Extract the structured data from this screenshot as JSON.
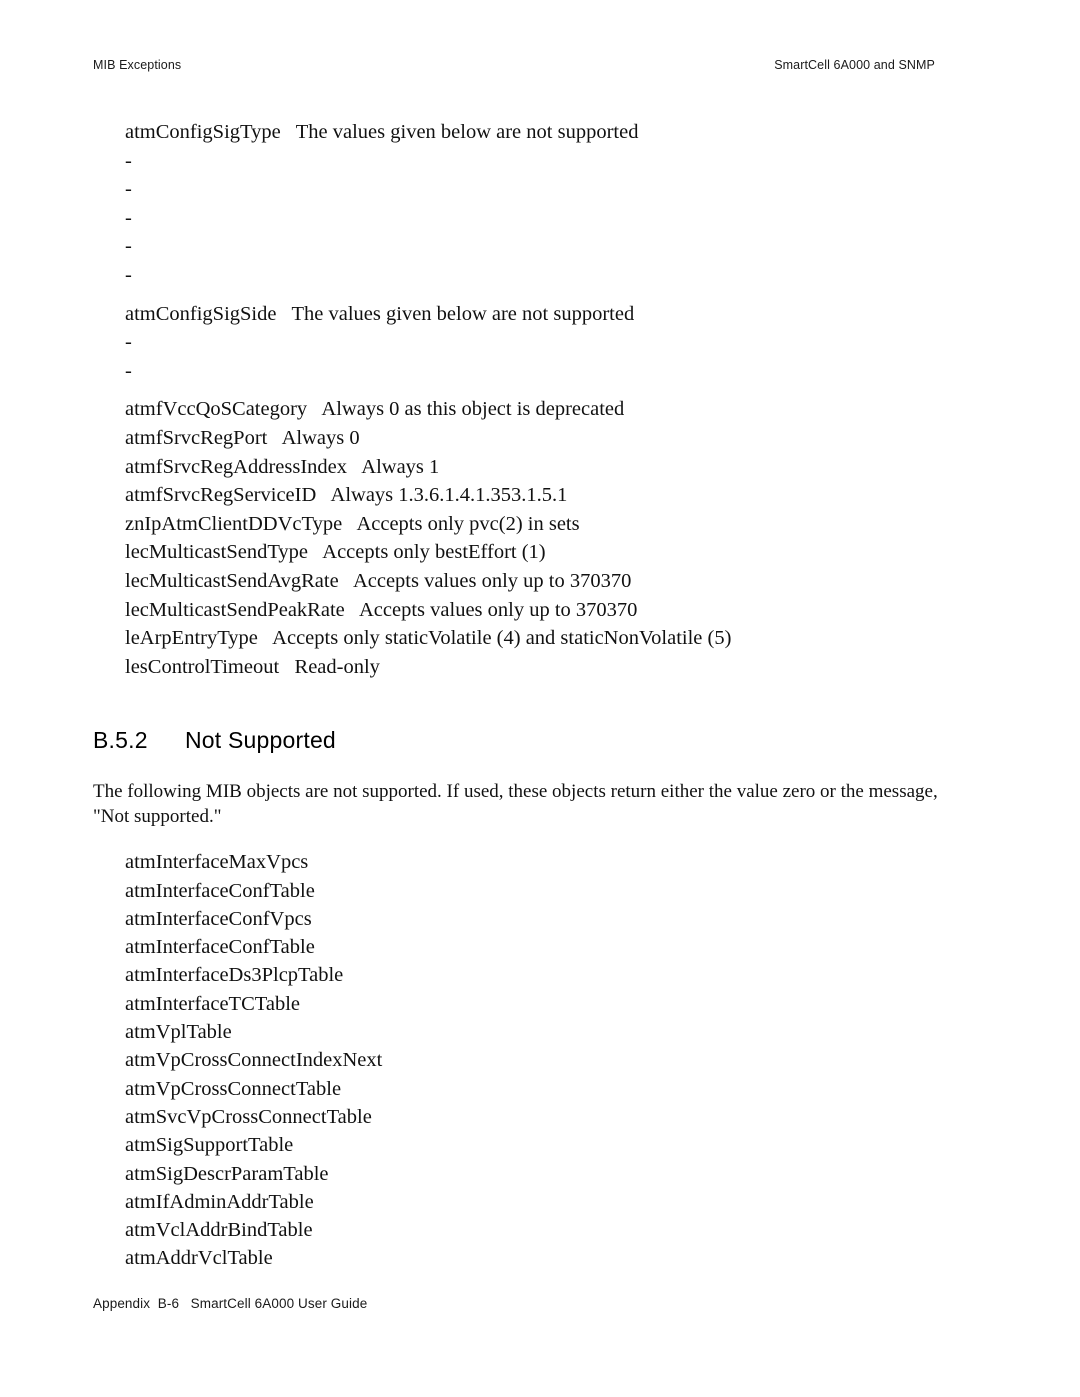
{
  "header": {
    "left": "MIB Exceptions",
    "right": "SmartCell 6A000 and SNMP"
  },
  "exceptions": {
    "entries": [
      {
        "name": "atmConfigSigType",
        "description": "The values given below are not supported",
        "dashes": 5
      },
      {
        "name": "atmConfigSigSide",
        "description": "The values given below are not supported",
        "dashes": 2
      },
      {
        "name": "atmfVccQoSCategory",
        "description": "Always 0 as this object is deprecated",
        "dashes": 0
      },
      {
        "name": "atmfSrvcRegPort",
        "description": "Always 0",
        "dashes": 0
      },
      {
        "name": "atmfSrvcRegAddressIndex",
        "description": "Always 1",
        "dashes": 0
      },
      {
        "name": "atmfSrvcRegServiceID",
        "description": "Always 1.3.6.1.4.1.353.1.5.1",
        "dashes": 0
      },
      {
        "name": "znIpAtmClientDDVcType",
        "description": "Accepts only pvc(2) in sets",
        "dashes": 0
      },
      {
        "name": "lecMulticastSendType",
        "description": "Accepts only bestEffort (1)",
        "dashes": 0
      },
      {
        "name": "lecMulticastSendAvgRate",
        "description": "Accepts values only up to 370370",
        "dashes": 0
      },
      {
        "name": "lecMulticastSendPeakRate",
        "description": "Accepts values only up to 370370",
        "dashes": 0
      },
      {
        "name": "leArpEntryType",
        "description": "Accepts only staticVolatile (4) and staticNonVolatile (5)",
        "dashes": 0
      },
      {
        "name": "lesControlTimeout",
        "description": "Read-only",
        "dashes": 0
      }
    ],
    "dash_glyph": "-"
  },
  "section": {
    "number": "B.5.2",
    "title": "Not Supported",
    "intro": "The following MIB objects are not supported. If used, these objects return either the value zero or the message, \"Not supported.\"",
    "items": [
      "atmInterfaceMaxVpcs",
      "atmInterfaceConfTable",
      "atmInterfaceConfVpcs",
      "atmInterfaceConfTable",
      "atmInterfaceDs3PlcpTable",
      "atmInterfaceTCTable",
      "atmVplTable",
      "atmVpCrossConnectIndexNext",
      "atmVpCrossConnectTable",
      "atmSvcVpCrossConnectTable",
      "atmSigSupportTable",
      "atmSigDescrParamTable",
      "atmIfAdminAddrTable",
      "atmVclAddrBindTable",
      "atmAddrVclTable"
    ]
  },
  "footer": {
    "text": "Appendix  B-6   SmartCell 6A000 User Guide"
  }
}
